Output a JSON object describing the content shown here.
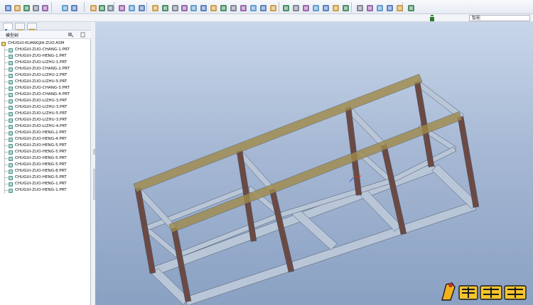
{
  "toolbar": {
    "icons": [
      "new-icon",
      "open-icon",
      "save-icon",
      "print-icon",
      "undo-icon",
      "redo-icon",
      "cut-icon",
      "copy-icon",
      "paste-icon",
      "regenerate-icon",
      "find-icon",
      "select-icon",
      "repaint-icon",
      "orient-icon",
      "spin-icon",
      "zoom-in-icon",
      "zoom-out-icon",
      "refit-icon",
      "view-manager-icon",
      "datum-planes-icon",
      "datum-axes-icon",
      "datum-points-icon",
      "csys-icon",
      "help-icon"
    ]
  },
  "search": {
    "value": "智能"
  },
  "left_panel": {
    "tree_title": "模型树",
    "root": "CHUGUI-KUANGJIA-ZUO.ASM",
    "items": [
      "CHUGUI-ZUO-CHANG-1.PRT",
      "CHUGUI-ZUO-HENG-1.PRT",
      "CHUGUI-ZUO-LIZHU-1.PRT",
      "CHUGUI-ZUO-CHANG-2.PRT",
      "CHUGUI-ZUO-LIZHU-2.PRT",
      "CHUGUI-ZUO-LIZHU-5.PRT",
      "CHUGUI-ZUO-CHANG-3.PRT",
      "CHUGUI-ZUO-CHANG-4.PRT",
      "CHUGUI-ZUO-LIZHU-3.PRT",
      "CHUGUI-ZUO-LIZHU-3.PRT",
      "CHUGUI-ZUO-LIZHU-5.PRT",
      "CHUGUI-ZUO-LIZHU-3.PRT",
      "CHUGUI-ZUO-LIZHU-4.PRT",
      "CHUGUI-ZUO-HENG-2.PRT",
      "CHUGUI-ZUO-HENG-4.PRT",
      "CHUGUI-ZUO-HENG-5.PRT",
      "CHUGUI-ZUO-HENG-5.PRT",
      "CHUGUI-ZUO-HENG-5.PRT",
      "CHUGUI-ZUO-HENG-5.PRT",
      "CHUGUI-ZUO-HENG-8.PRT",
      "CHUGUI-ZUO-HENG-5.PRT",
      "CHUGUI-ZUO-HENG-1.PRT",
      "CHUGUI-ZUO-HENG-1.PRT"
    ]
  },
  "colors": {
    "post": "#6b4a44",
    "beam": "#b8c6d8",
    "top_beam": "#a08a49",
    "viewport_top": "#c8d6ea",
    "viewport_bottom": "#8aa1c3"
  },
  "watermark": {
    "icon": "watermark-logo-icon"
  }
}
